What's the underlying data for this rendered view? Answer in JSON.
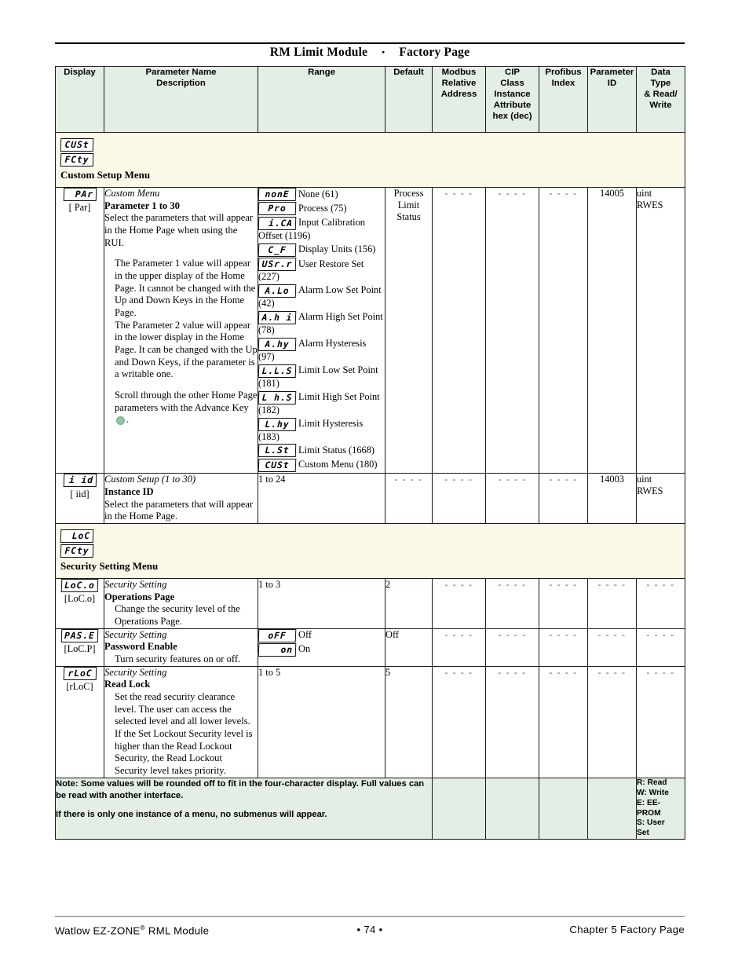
{
  "header": {
    "doc_title_left": "RM Limit Module",
    "doc_title_sep": "•",
    "doc_title_right": "Factory Page"
  },
  "table": {
    "columns": [
      "Display",
      "Parameter Name\nDescription",
      "Range",
      "Default",
      "Modbus Relative Address",
      "CIP Class Instance Attribute hex (dec)",
      "Profibus Index",
      "Parameter ID",
      "Data Type & Read/ Write"
    ],
    "col_display": "Display",
    "col_param_name": "Parameter Name",
    "col_param_desc": "Description",
    "col_range": "Range",
    "col_default": "Default",
    "col_modbus_1": "Modbus",
    "col_modbus_2": "Relative",
    "col_modbus_3": "Address",
    "col_cip_1": "CIP",
    "col_cip_2": "Class",
    "col_cip_3": "Instance",
    "col_cip_4": "Attribute",
    "col_cip_5": "hex (dec)",
    "col_profibus_1": "Profibus",
    "col_profibus_2": "Index",
    "col_paramid_1": "Parameter",
    "col_paramid_2": "ID",
    "col_datatype_1": "Data",
    "col_datatype_2": "Type",
    "col_datatype_3": "& Read/",
    "col_datatype_4": "Write"
  },
  "menu_custom": {
    "lcd_line1": "CUSt",
    "lcd_line2": "FCty",
    "caption": "Custom Setup Menu"
  },
  "menu_security": {
    "lcd_line1": "LoC",
    "lcd_line2": "FCty",
    "caption": "Security Setting Menu"
  },
  "row_parameter": {
    "display_lcd": "PAr",
    "display_bracket": "[ Par]",
    "name_italic": "Custom Menu",
    "name_bold": "Parameter 1 to 30",
    "desc_1": "Select the parameters that will appear in the Home Page when using the RUI.",
    "desc_2": "The Parameter 1 value will appear in the upper display of the Home Page. It cannot be changed with the Up and Down Keys in the Home Page.",
    "desc_3": "The Parameter 2 value will appear in the lower display in the Home Page. It can be changed with the Up and Down Keys, if the parameter is a writable one.",
    "desc_4_pre": "Scroll through the other Home Page parameters with the Advance Key",
    "desc_4_post": ".",
    "range_options": [
      {
        "lcd": "nonE",
        "label": "None (61)"
      },
      {
        "lcd": "Pro",
        "label": "Process (75)"
      },
      {
        "lcd": "i.CA",
        "label": "Input Calibration Offset (1196)"
      },
      {
        "lcd": "C_F",
        "label": "Display Units (156)"
      },
      {
        "lcd": "USr.r",
        "label": "User Restore Set (227)"
      },
      {
        "lcd": "A.Lo",
        "label": "Alarm Low Set Point (42)"
      },
      {
        "lcd": "A.h i",
        "label": "Alarm High Set Point (78)"
      },
      {
        "lcd": "A.hy",
        "label": "Alarm Hysteresis (97)"
      },
      {
        "lcd": "L.L.S",
        "label": "Limit Low Set Point (181)"
      },
      {
        "lcd": "L h.S",
        "label": "Limit High Set Point (182)"
      },
      {
        "lcd": "L.hy",
        "label": "Limit Hysteresis (183)"
      },
      {
        "lcd": "L.St",
        "label": "Limit Status (1668)"
      },
      {
        "lcd": "CUSt",
        "label": "Custom Menu (180)"
      }
    ],
    "default_1": "Process",
    "default_2": "Limit",
    "default_3": "Status",
    "modbus": "- - - -",
    "cip": "- - - -",
    "profibus": "- - - -",
    "param_id": "14005",
    "data_type_1": "uint",
    "data_type_2": "RWES"
  },
  "row_instance": {
    "display_lcd": "i id",
    "display_bracket": "[ iid]",
    "name_italic": "Custom Setup (1 to 30)",
    "name_bold": "Instance ID",
    "desc_1": "Select the parameters that will appear in the Home Page.",
    "range": "1 to 24",
    "default": "- - - -",
    "modbus": "- - - -",
    "cip": "- - - -",
    "profibus": "- - - -",
    "param_id": "14003",
    "data_type_1": "uint",
    "data_type_2": "RWES"
  },
  "row_operations": {
    "display_lcd": "LoC.o",
    "display_bracket": "[LoC.o]",
    "name_italic": "Security Setting",
    "name_bold": "Operations Page",
    "desc_1": "Change the security level of the Operations Page.",
    "range": "1 to 3",
    "default": "2",
    "modbus": "- - - -",
    "cip": "- - - -",
    "profibus": "- - - -",
    "param_id": "- - - -",
    "data_type": "- - - -"
  },
  "row_password": {
    "display_lcd": "PAS.E",
    "display_bracket": "[LoC.P]",
    "name_italic": "Security Setting",
    "name_bold": "Password Enable",
    "desc_1": "Turn security features on or off.",
    "range_options": [
      {
        "lcd": "oFF",
        "label": "Off"
      },
      {
        "lcd": "on",
        "label": "On"
      }
    ],
    "default": "Off",
    "modbus": "- - - -",
    "cip": "- - - -",
    "profibus": "- - - -",
    "param_id": "- - - -",
    "data_type": "- - - -"
  },
  "row_readlock": {
    "display_lcd": "rLoC",
    "display_bracket": "[rLoC]",
    "name_italic": "Security Setting",
    "name_bold": "Read Lock",
    "desc_1": "Set the read security clearance level. The user can access the selected level and all lower levels.",
    "desc_2": "If the Set Lockout Security level is higher than the Read Lockout Security, the Read Lockout Security level takes priority.",
    "range": "1 to 5",
    "default": "5",
    "modbus": "- - - -",
    "cip": "- - - -",
    "profibus": "- - - -",
    "param_id": "- - - -",
    "data_type": "- - - -"
  },
  "note_row": {
    "note_1": "Note: Some values will be rounded off to fit in the four-character display. Full values can be read with another interface.",
    "note_2": "If there is only one instance of a menu, no submenus will appear.",
    "legend_1": "R: Read",
    "legend_2": "W: Write",
    "legend_3": "E: EE-",
    "legend_4": "PROM",
    "legend_5": "S: User",
    "legend_6": "Set"
  },
  "footer": {
    "left_pre": "Watlow EZ-ZONE",
    "left_sup": "®",
    "left_post": " RML Module",
    "center": "•  74  •",
    "right": "Chapter 5 Factory Page"
  },
  "colors": {
    "header_tint": "#e3eee4",
    "menu_band_tint": "#fbf8e8",
    "advance_key_green": "#8cc9a4",
    "border": "#1a1a1a"
  }
}
